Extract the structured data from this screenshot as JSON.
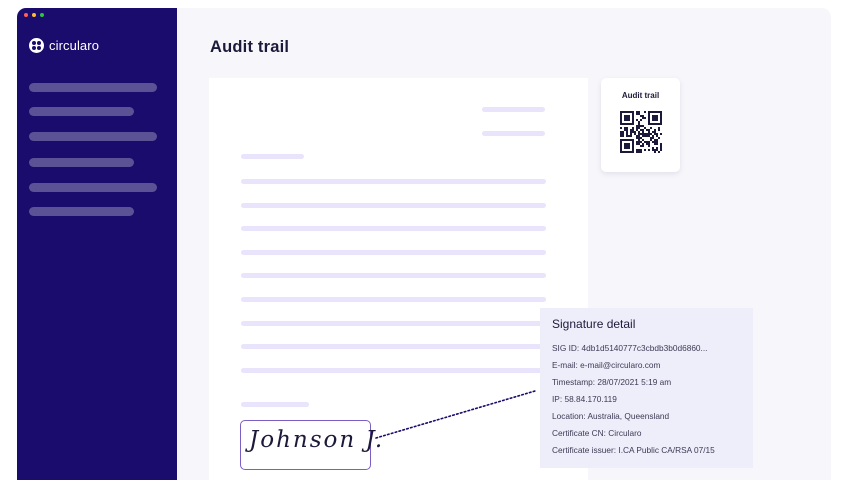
{
  "app": {
    "name": "circularo"
  },
  "header": {
    "title": "Audit trail"
  },
  "sidebar": {
    "items": [
      {
        "label": ""
      },
      {
        "label": ""
      },
      {
        "label": ""
      },
      {
        "label": ""
      },
      {
        "label": ""
      },
      {
        "label": ""
      }
    ]
  },
  "qr_card": {
    "label": "Audit trail",
    "icon": "qr-code-icon"
  },
  "signature": {
    "text": "Johnson J."
  },
  "signature_detail": {
    "title": "Signature detail",
    "rows": [
      "SIG ID: 4db1d5140777c3cbdb3b0d6860...",
      "E-mail: e-mail@circularo.com",
      "Timestamp: 28/07/2021 5:19 am",
      "IP: 58.84.170.119",
      "Location: Australia, Queensland",
      "Certificate CN: Circularo",
      "Certificate issuer: I.CA Public CA/RSA 07/15"
    ]
  },
  "colors": {
    "sidebar": "#1a0c6d",
    "nav_placeholder": "#5b5296",
    "doc_line": "#e9e3fb",
    "accent": "#7b5fc4",
    "detail_bg": "#eeeefa",
    "traffic_red": "#ff5f57",
    "traffic_yellow": "#febc2e",
    "traffic_green": "#28c840"
  }
}
